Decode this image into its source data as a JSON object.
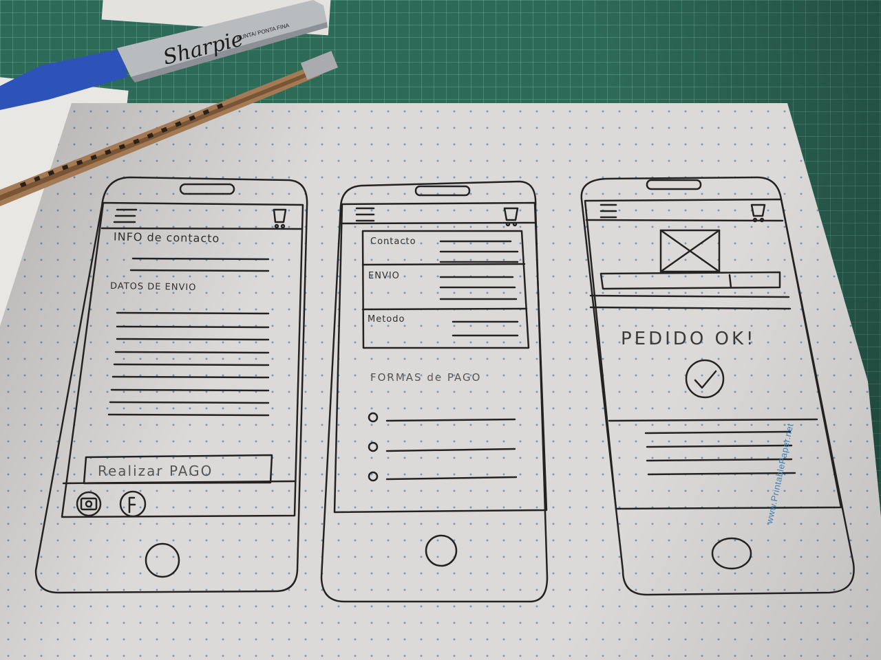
{
  "pens": {
    "marker_brand": "Sharpie",
    "marker_small_text": "PUNTA/ PONTA FINA"
  },
  "paper": {
    "watermark": "www.PrintablePaper.net"
  },
  "screen1": {
    "contact_label": "INFO de contacto",
    "shipping_label": "DATOS DE ENVIO",
    "pay_button": "Realizar PAGO"
  },
  "screen2": {
    "section_contact": "Contacto",
    "section_shipping": "ENVIO",
    "section_method": "Metodo",
    "payment_forms_label": "FORMAS de PAGO"
  },
  "screen3": {
    "order_ok": "PEDIDO OK!"
  },
  "colors": {
    "ink": "#222222",
    "paper": "#dcdad8",
    "mat": "#2e6a58",
    "dots": "#7a9cae"
  }
}
